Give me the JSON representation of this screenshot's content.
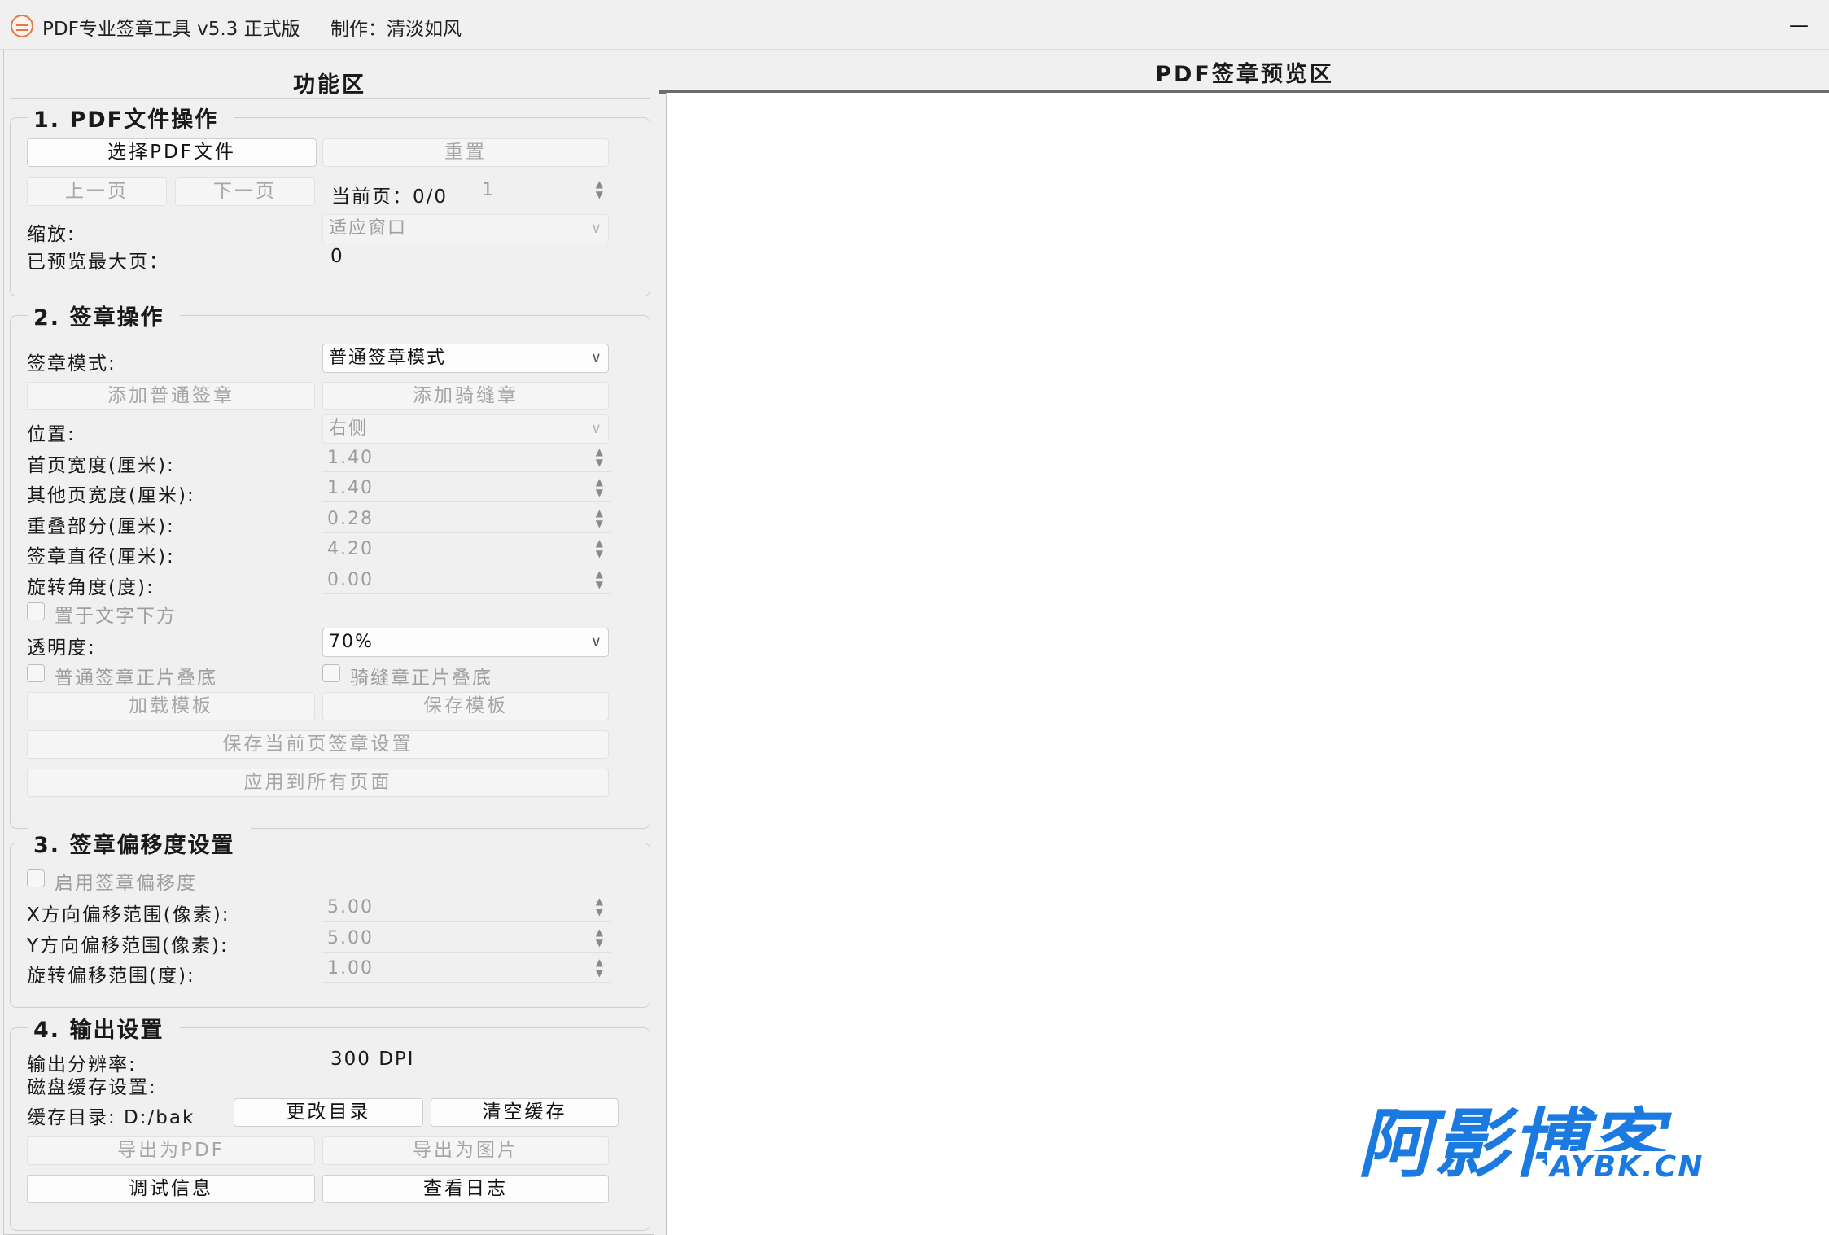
{
  "window": {
    "title": "PDF专业签章工具 v5.3 正式版",
    "author": "制作：清淡如风",
    "minimize": "—"
  },
  "left_panel": {
    "title": "功能区",
    "section1": {
      "title": "1. PDF文件操作",
      "select_pdf": "选择PDF文件",
      "reset": "重置",
      "prev_page": "上一页",
      "next_page": "下一页",
      "current_page_label": "当前页：0/0",
      "current_page_value": "1",
      "zoom_label": "缩放:",
      "zoom_value": "适应窗口",
      "max_preview_label": "已预览最大页：",
      "max_preview_value": "0"
    },
    "section2": {
      "title": "2. 签章操作",
      "mode_label": "签章模式:",
      "mode_value": "普通签章模式",
      "add_normal": "添加普通签章",
      "add_riding": "添加骑缝章",
      "position_label": "位置:",
      "position_value": "右侧",
      "first_width_label": "首页宽度(厘米):",
      "first_width_value": "1.40",
      "other_width_label": "其他页宽度(厘米):",
      "other_width_value": "1.40",
      "overlap_label": "重叠部分(厘米):",
      "overlap_value": "0.28",
      "diameter_label": "签章直径(厘米):",
      "diameter_value": "4.20",
      "rotation_label": "旋转角度(度):",
      "rotation_value": "0.00",
      "below_text": "置于文字下方",
      "opacity_label": "透明度:",
      "opacity_value": "70%",
      "normal_multiply": "普通签章正片叠底",
      "riding_multiply": "骑缝章正片叠底",
      "load_template": "加载模板",
      "save_template": "保存模板",
      "save_page_settings": "保存当前页签章设置",
      "apply_all": "应用到所有页面"
    },
    "section3": {
      "title": "3. 签章偏移度设置",
      "enable_offset": "启用签章偏移度",
      "x_label": "X方向偏移范围(像素):",
      "x_value": "5.00",
      "y_label": "Y方向偏移范围(像素):",
      "y_value": "5.00",
      "rot_label": "旋转偏移范围(度):",
      "rot_value": "1.00"
    },
    "section4": {
      "title": "4. 输出设置",
      "resolution_label": "输出分辨率:",
      "resolution_value": "300 DPI",
      "disk_cache_label": "磁盘缓存设置:",
      "cache_dir_label": "缓存目录: D:/bak",
      "change_dir": "更改目录",
      "clear_cache": "清空缓存",
      "export_pdf": "导出为PDF",
      "export_image": "导出为图片",
      "debug_info": "调试信息",
      "view_log": "查看日志"
    }
  },
  "right_panel": {
    "title": "PDF签章预览区"
  },
  "watermark": {
    "text_cn": "阿影博客",
    "text_en": "AYBK.CN",
    "color": "#1a7ae0"
  }
}
